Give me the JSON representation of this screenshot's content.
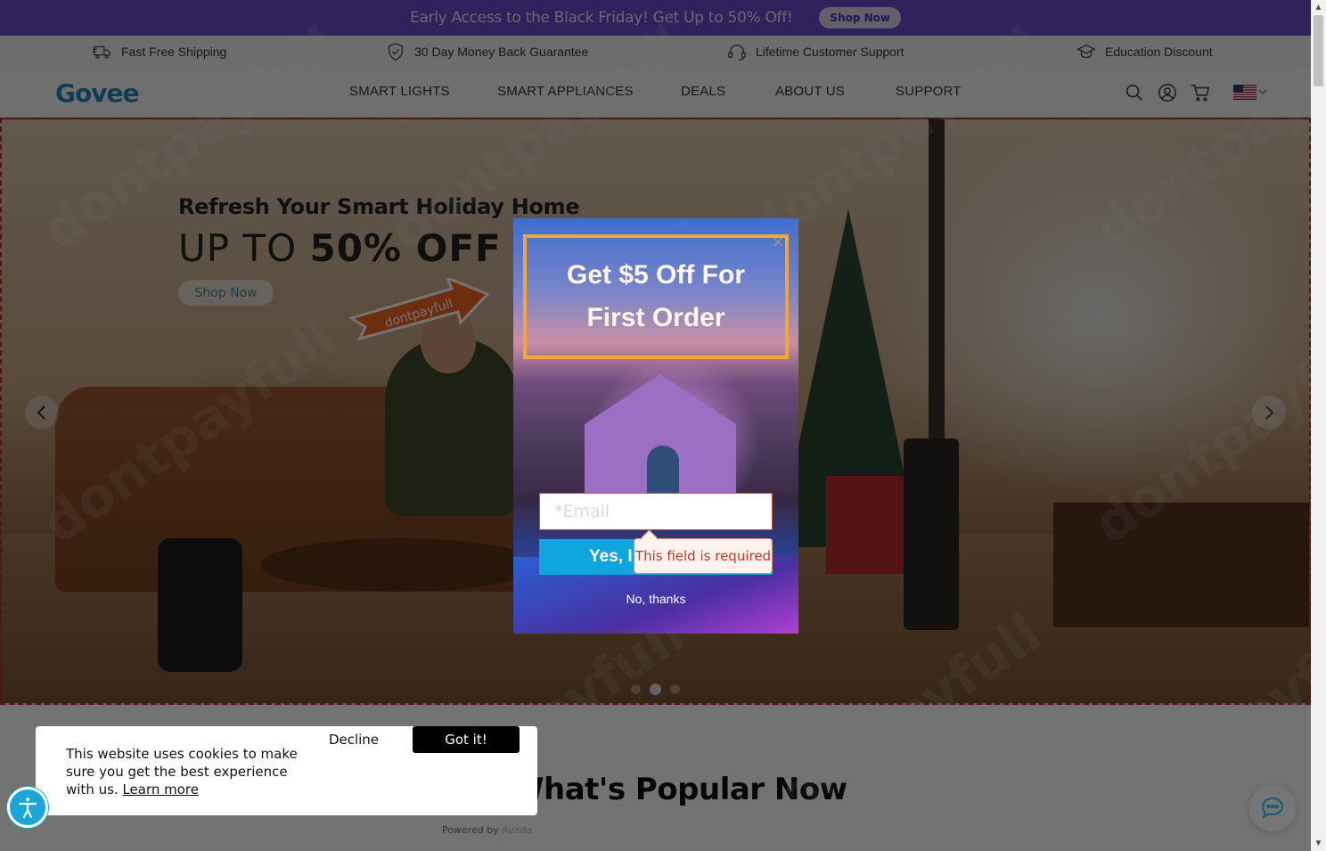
{
  "announcement": {
    "text": "Early Access to the Black Friday! Get Up to 50% Off!",
    "button": "Shop Now"
  },
  "usp": [
    {
      "icon": "truck-icon",
      "label": "Fast Free Shipping"
    },
    {
      "icon": "shield-check-icon",
      "label": "30 Day Money Back Guarantee"
    },
    {
      "icon": "headset-icon",
      "label": "Lifetime Customer Support"
    },
    {
      "icon": "graduation-cap-icon",
      "label": "Education Discount"
    }
  ],
  "header": {
    "logo": "Govee",
    "nav": [
      "SMART LIGHTS",
      "SMART APPLIANCES",
      "DEALS",
      "ABOUT US",
      "SUPPORT"
    ],
    "icons": [
      "search-icon",
      "account-icon",
      "cart-icon",
      "us-flag-icon"
    ]
  },
  "hero": {
    "subtitle": "Refresh Your Smart Holiday Home",
    "title_prefix": "UP TO ",
    "title_bold": "50% OFF",
    "button": "Shop Now",
    "promo_tag": "dontpayfull",
    "slides_total": 3,
    "active_slide": 2
  },
  "popup": {
    "title_line1": "Get $5 Off For",
    "title_line2": "First Order",
    "close": "×",
    "email_placeholder": "*Email",
    "email_value": "",
    "submit_label": "Yes, I",
    "error_text": "This field is required",
    "dismiss_label": "No, thanks"
  },
  "cookie": {
    "text": "This website uses cookies to make sure you get the best experience with us.",
    "learn_more": "Learn more",
    "decline": "Decline",
    "accept": "Got it!",
    "powered_prefix": "Powered by ",
    "powered_brand": "Avada"
  },
  "section": {
    "title": "What's Popular Now"
  },
  "watermark": "dontpayfull",
  "colors": {
    "announcement_bg": "#6a47c9",
    "brand_blue": "#1e86b8",
    "popup_border": "#f3a43a",
    "submit_blue": "#0fa5dd",
    "error_red": "#c0392b"
  }
}
